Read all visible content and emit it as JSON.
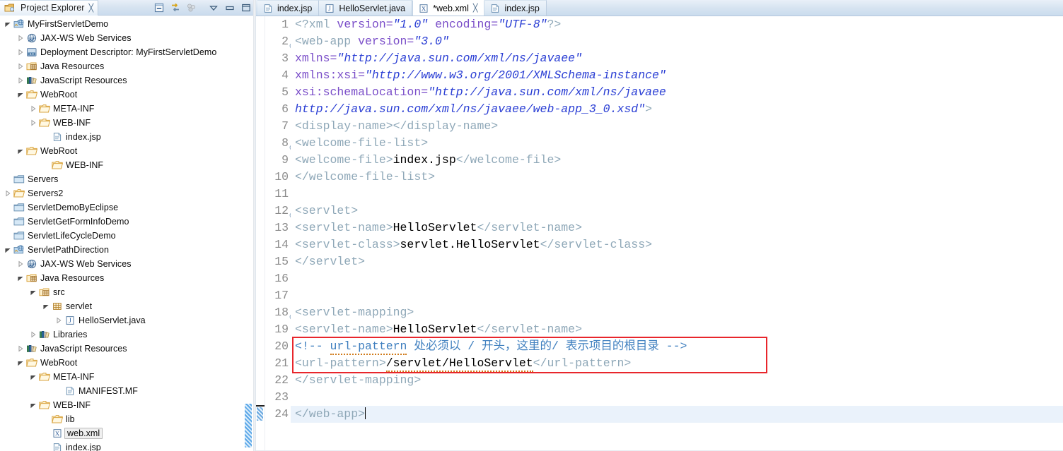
{
  "explorer": {
    "tab_label": "Project Explorer",
    "tab_close_glyph": "╳",
    "icon_name": "project-explorer-icon",
    "toolbar": [
      {
        "name": "collapse-all-icon",
        "title": "Collapse All"
      },
      {
        "name": "link-with-editor-icon",
        "title": "Link with Editor"
      },
      {
        "name": "view-menu-icon",
        "title": "View Menu"
      },
      {
        "name": "chevron-down-icon",
        "title": "Minimize dropdown"
      },
      {
        "name": "minimize-icon",
        "title": "Minimize"
      },
      {
        "name": "maximize-icon",
        "title": "Maximize"
      }
    ],
    "tree": [
      {
        "label": "MyFirstServletDemo",
        "indent": 0,
        "arrow": "open",
        "icon": "web-project-icon"
      },
      {
        "label": "JAX-WS Web Services",
        "indent": 1,
        "arrow": "closed",
        "icon": "jaxws-icon"
      },
      {
        "label": "Deployment Descriptor: MyFirstServletDemo",
        "indent": 1,
        "arrow": "closed",
        "icon": "deployment-descriptor-icon"
      },
      {
        "label": "Java Resources",
        "indent": 1,
        "arrow": "closed",
        "icon": "java-resources-icon"
      },
      {
        "label": "JavaScript Resources",
        "indent": 1,
        "arrow": "closed",
        "icon": "javascript-resources-icon"
      },
      {
        "label": "WebRoot",
        "indent": 1,
        "arrow": "open",
        "icon": "folder-icon"
      },
      {
        "label": "META-INF",
        "indent": 2,
        "arrow": "closed",
        "icon": "folder-icon"
      },
      {
        "label": "WEB-INF",
        "indent": 2,
        "arrow": "closed",
        "icon": "folder-icon"
      },
      {
        "label": "index.jsp",
        "indent": 3,
        "arrow": "none",
        "icon": "jsp-file-icon"
      },
      {
        "label": "WebRoot",
        "indent": 1,
        "arrow": "open",
        "icon": "folder-icon"
      },
      {
        "label": "WEB-INF",
        "indent": 3,
        "arrow": "none",
        "icon": "folder-icon"
      },
      {
        "label": "Servers",
        "indent": 0,
        "arrow": "none",
        "icon": "project-closed-icon"
      },
      {
        "label": "Servers2",
        "indent": 0,
        "arrow": "closed",
        "icon": "folder-icon"
      },
      {
        "label": "ServletDemoByEclipse",
        "indent": 0,
        "arrow": "none",
        "icon": "project-closed-icon"
      },
      {
        "label": "ServletGetFormInfoDemo",
        "indent": 0,
        "arrow": "none",
        "icon": "project-closed-icon"
      },
      {
        "label": "ServletLifeCycleDemo",
        "indent": 0,
        "arrow": "none",
        "icon": "project-closed-icon"
      },
      {
        "label": "ServletPathDirection",
        "indent": 0,
        "arrow": "open",
        "icon": "web-project-icon"
      },
      {
        "label": "JAX-WS Web Services",
        "indent": 1,
        "arrow": "closed",
        "icon": "jaxws-icon"
      },
      {
        "label": "Java Resources",
        "indent": 1,
        "arrow": "open",
        "icon": "java-resources-icon"
      },
      {
        "label": "src",
        "indent": 2,
        "arrow": "open",
        "icon": "source-folder-icon"
      },
      {
        "label": "servlet",
        "indent": 3,
        "arrow": "open",
        "icon": "package-icon"
      },
      {
        "label": "HelloServlet.java",
        "indent": 4,
        "arrow": "closed",
        "icon": "java-file-icon"
      },
      {
        "label": "Libraries",
        "indent": 2,
        "arrow": "closed",
        "icon": "libraries-icon"
      },
      {
        "label": "JavaScript Resources",
        "indent": 1,
        "arrow": "closed",
        "icon": "javascript-resources-icon"
      },
      {
        "label": "WebRoot",
        "indent": 1,
        "arrow": "open",
        "icon": "folder-icon"
      },
      {
        "label": "META-INF",
        "indent": 2,
        "arrow": "open",
        "icon": "folder-icon"
      },
      {
        "label": "MANIFEST.MF",
        "indent": 4,
        "arrow": "none",
        "icon": "manifest-file-icon"
      },
      {
        "label": "WEB-INF",
        "indent": 2,
        "arrow": "open",
        "icon": "folder-icon"
      },
      {
        "label": "lib",
        "indent": 3,
        "arrow": "none",
        "icon": "folder-icon"
      },
      {
        "label": "web.xml",
        "indent": 3,
        "arrow": "none",
        "icon": "xml-file-icon",
        "selected": true
      },
      {
        "label": "index.jsp",
        "indent": 3,
        "arrow": "none",
        "icon": "jsp-file-icon"
      }
    ]
  },
  "editor": {
    "tabs": [
      {
        "label": "index.jsp",
        "icon": "jsp-file-icon",
        "active": false,
        "closable": false
      },
      {
        "label": "HelloServlet.java",
        "icon": "java-file-icon",
        "active": false,
        "closable": false
      },
      {
        "label": "*web.xml",
        "icon": "xml-file-icon",
        "active": true,
        "closable": true
      },
      {
        "label": "index.jsp",
        "icon": "jsp-file-icon",
        "active": false,
        "closable": false
      }
    ],
    "tab_close_glyph": "╳",
    "current_line": 24,
    "lines": [
      {
        "n": 1,
        "fold": false,
        "current": false,
        "spans": [
          {
            "t": "<?xml ",
            "c": "tag"
          },
          {
            "t": "version=",
            "c": "attr"
          },
          {
            "t": "\"1.0\"",
            "c": "str"
          },
          {
            "t": " ",
            "c": "plain"
          },
          {
            "t": "encoding=",
            "c": "attr"
          },
          {
            "t": "\"UTF-8\"",
            "c": "str"
          },
          {
            "t": "?>",
            "c": "tag"
          }
        ]
      },
      {
        "n": 2,
        "fold": true,
        "current": false,
        "spans": [
          {
            "t": "<web-app ",
            "c": "tag"
          },
          {
            "t": "version=",
            "c": "attr"
          },
          {
            "t": "\"3.0\"",
            "c": "str"
          }
        ]
      },
      {
        "n": 3,
        "fold": false,
        "current": false,
        "spans": [
          {
            "t": "xmlns=",
            "c": "attr"
          },
          {
            "t": "\"http://java.sun.com/xml/ns/javaee\"",
            "c": "str"
          }
        ]
      },
      {
        "n": 4,
        "fold": false,
        "current": false,
        "spans": [
          {
            "t": "xmlns:xsi=",
            "c": "attr"
          },
          {
            "t": "\"http://www.w3.org/2001/XMLSchema-instance\"",
            "c": "str"
          }
        ]
      },
      {
        "n": 5,
        "fold": false,
        "current": false,
        "spans": [
          {
            "t": "xsi:schemaLocation=",
            "c": "attr"
          },
          {
            "t": "\"http://java.sun.com/xml/ns/javaee",
            "c": "str"
          }
        ]
      },
      {
        "n": 6,
        "fold": false,
        "current": false,
        "spans": [
          {
            "t": "http://java.sun.com/xml/ns/javaee/web-app_3_0.xsd\"",
            "c": "str"
          },
          {
            "t": ">",
            "c": "tag"
          }
        ]
      },
      {
        "n": 7,
        "fold": false,
        "current": false,
        "spans": [
          {
            "t": "<display-name></display-name>",
            "c": "tag"
          }
        ]
      },
      {
        "n": 8,
        "fold": true,
        "current": false,
        "spans": [
          {
            "t": "<welcome-file-list>",
            "c": "tag"
          }
        ]
      },
      {
        "n": 9,
        "fold": false,
        "current": false,
        "spans": [
          {
            "t": "<welcome-file>",
            "c": "tag"
          },
          {
            "t": "index.jsp",
            "c": "txt"
          },
          {
            "t": "</welcome-file>",
            "c": "tag"
          }
        ]
      },
      {
        "n": 10,
        "fold": false,
        "current": false,
        "spans": [
          {
            "t": "</welcome-file-list>",
            "c": "tag"
          }
        ]
      },
      {
        "n": 11,
        "fold": false,
        "current": false,
        "spans": []
      },
      {
        "n": 12,
        "fold": true,
        "current": false,
        "spans": [
          {
            "t": "<servlet>",
            "c": "tag"
          }
        ]
      },
      {
        "n": 13,
        "fold": false,
        "current": false,
        "spans": [
          {
            "t": "<servlet-name>",
            "c": "tag"
          },
          {
            "t": "HelloServlet",
            "c": "txt"
          },
          {
            "t": "</servlet-name>",
            "c": "tag"
          }
        ]
      },
      {
        "n": 14,
        "fold": false,
        "current": false,
        "spans": [
          {
            "t": "<servlet-class>",
            "c": "tag"
          },
          {
            "t": "servlet.HelloServlet",
            "c": "txt"
          },
          {
            "t": "</servlet-class>",
            "c": "tag"
          }
        ]
      },
      {
        "n": 15,
        "fold": false,
        "current": false,
        "spans": [
          {
            "t": "</servlet>",
            "c": "tag"
          }
        ]
      },
      {
        "n": 16,
        "fold": false,
        "current": false,
        "spans": []
      },
      {
        "n": 17,
        "fold": false,
        "current": false,
        "spans": []
      },
      {
        "n": 18,
        "fold": true,
        "current": false,
        "spans": [
          {
            "t": "<servlet-mapping>",
            "c": "tag"
          }
        ]
      },
      {
        "n": 19,
        "fold": false,
        "current": false,
        "spans": [
          {
            "t": "<servlet-name>",
            "c": "tag"
          },
          {
            "t": "HelloServlet",
            "c": "txt"
          },
          {
            "t": "</servlet-name>",
            "c": "tag"
          }
        ]
      },
      {
        "n": 20,
        "fold": false,
        "current": false,
        "spans": [
          {
            "t": "<!-- ",
            "c": "cmt"
          },
          {
            "t": "url-pattern",
            "c": "cmt squig"
          },
          {
            "t": " 处必须以 / 开头，这里的/ 表示项目的根目录 -->",
            "c": "cmt"
          }
        ]
      },
      {
        "n": 21,
        "fold": false,
        "current": false,
        "spans": [
          {
            "t": "<url-pattern>",
            "c": "tag"
          },
          {
            "t": "/servlet/HelloServlet",
            "c": "txt squig"
          },
          {
            "t": "</url-pattern>",
            "c": "tag"
          }
        ]
      },
      {
        "n": 22,
        "fold": false,
        "current": false,
        "spans": [
          {
            "t": "</servlet-mapping>",
            "c": "tag"
          }
        ]
      },
      {
        "n": 23,
        "fold": false,
        "current": false,
        "spans": []
      },
      {
        "n": 24,
        "fold": false,
        "current": true,
        "spans": [
          {
            "t": "</web-app>",
            "c": "tag"
          }
        ]
      }
    ],
    "annotation": {
      "name": "red-highlight-box",
      "color": "#e8262c",
      "covers_lines": [
        20,
        21
      ]
    }
  }
}
